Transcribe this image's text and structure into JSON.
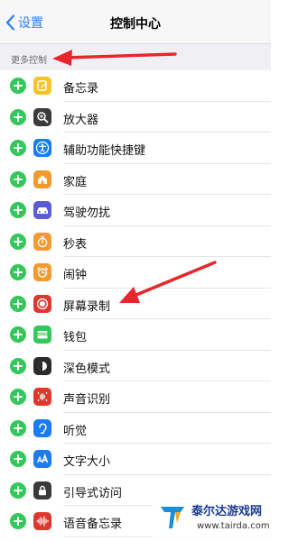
{
  "nav": {
    "back_label": "设置",
    "title": "控制中心"
  },
  "section": {
    "label": "更多控制"
  },
  "items": [
    {
      "label": "备忘录",
      "icon": "notes-icon",
      "color": "#f7c325"
    },
    {
      "label": "放大器",
      "icon": "magnifier-icon",
      "color": "#3a3a3c"
    },
    {
      "label": "辅助功能快捷键",
      "icon": "accessibility-icon",
      "color": "#1a7cf2"
    },
    {
      "label": "家庭",
      "icon": "home-icon",
      "color": "#f29a2e"
    },
    {
      "label": "驾驶勿扰",
      "icon": "car-icon",
      "color": "#5b5bd6"
    },
    {
      "label": "秒表",
      "icon": "stopwatch-icon",
      "color": "#f29a2e"
    },
    {
      "label": "闹钟",
      "icon": "alarm-icon",
      "color": "#f29a2e"
    },
    {
      "label": "屏幕录制",
      "icon": "screen-record-icon",
      "color": "#e0382f"
    },
    {
      "label": "钱包",
      "icon": "wallet-icon",
      "color": "#34c759"
    },
    {
      "label": "深色模式",
      "icon": "dark-mode-icon",
      "color": "#2c2c2e"
    },
    {
      "label": "声音识别",
      "icon": "sound-recognition-icon",
      "color": "#e0382f"
    },
    {
      "label": "听觉",
      "icon": "hearing-icon",
      "color": "#1a7cf2"
    },
    {
      "label": "文字大小",
      "icon": "text-size-icon",
      "color": "#1a7cf2"
    },
    {
      "label": "引导式访问",
      "icon": "guided-access-icon",
      "color": "#3a3a3c"
    },
    {
      "label": "语音备忘录",
      "icon": "voice-memo-icon",
      "color": "#e0382f"
    }
  ],
  "watermark": {
    "title": "泰尔达游戏网",
    "url": "www.tairda.com"
  },
  "colors": {
    "accent": "#2f7cf6",
    "add": "#34c759",
    "annotation_arrow": "#e8262b"
  }
}
